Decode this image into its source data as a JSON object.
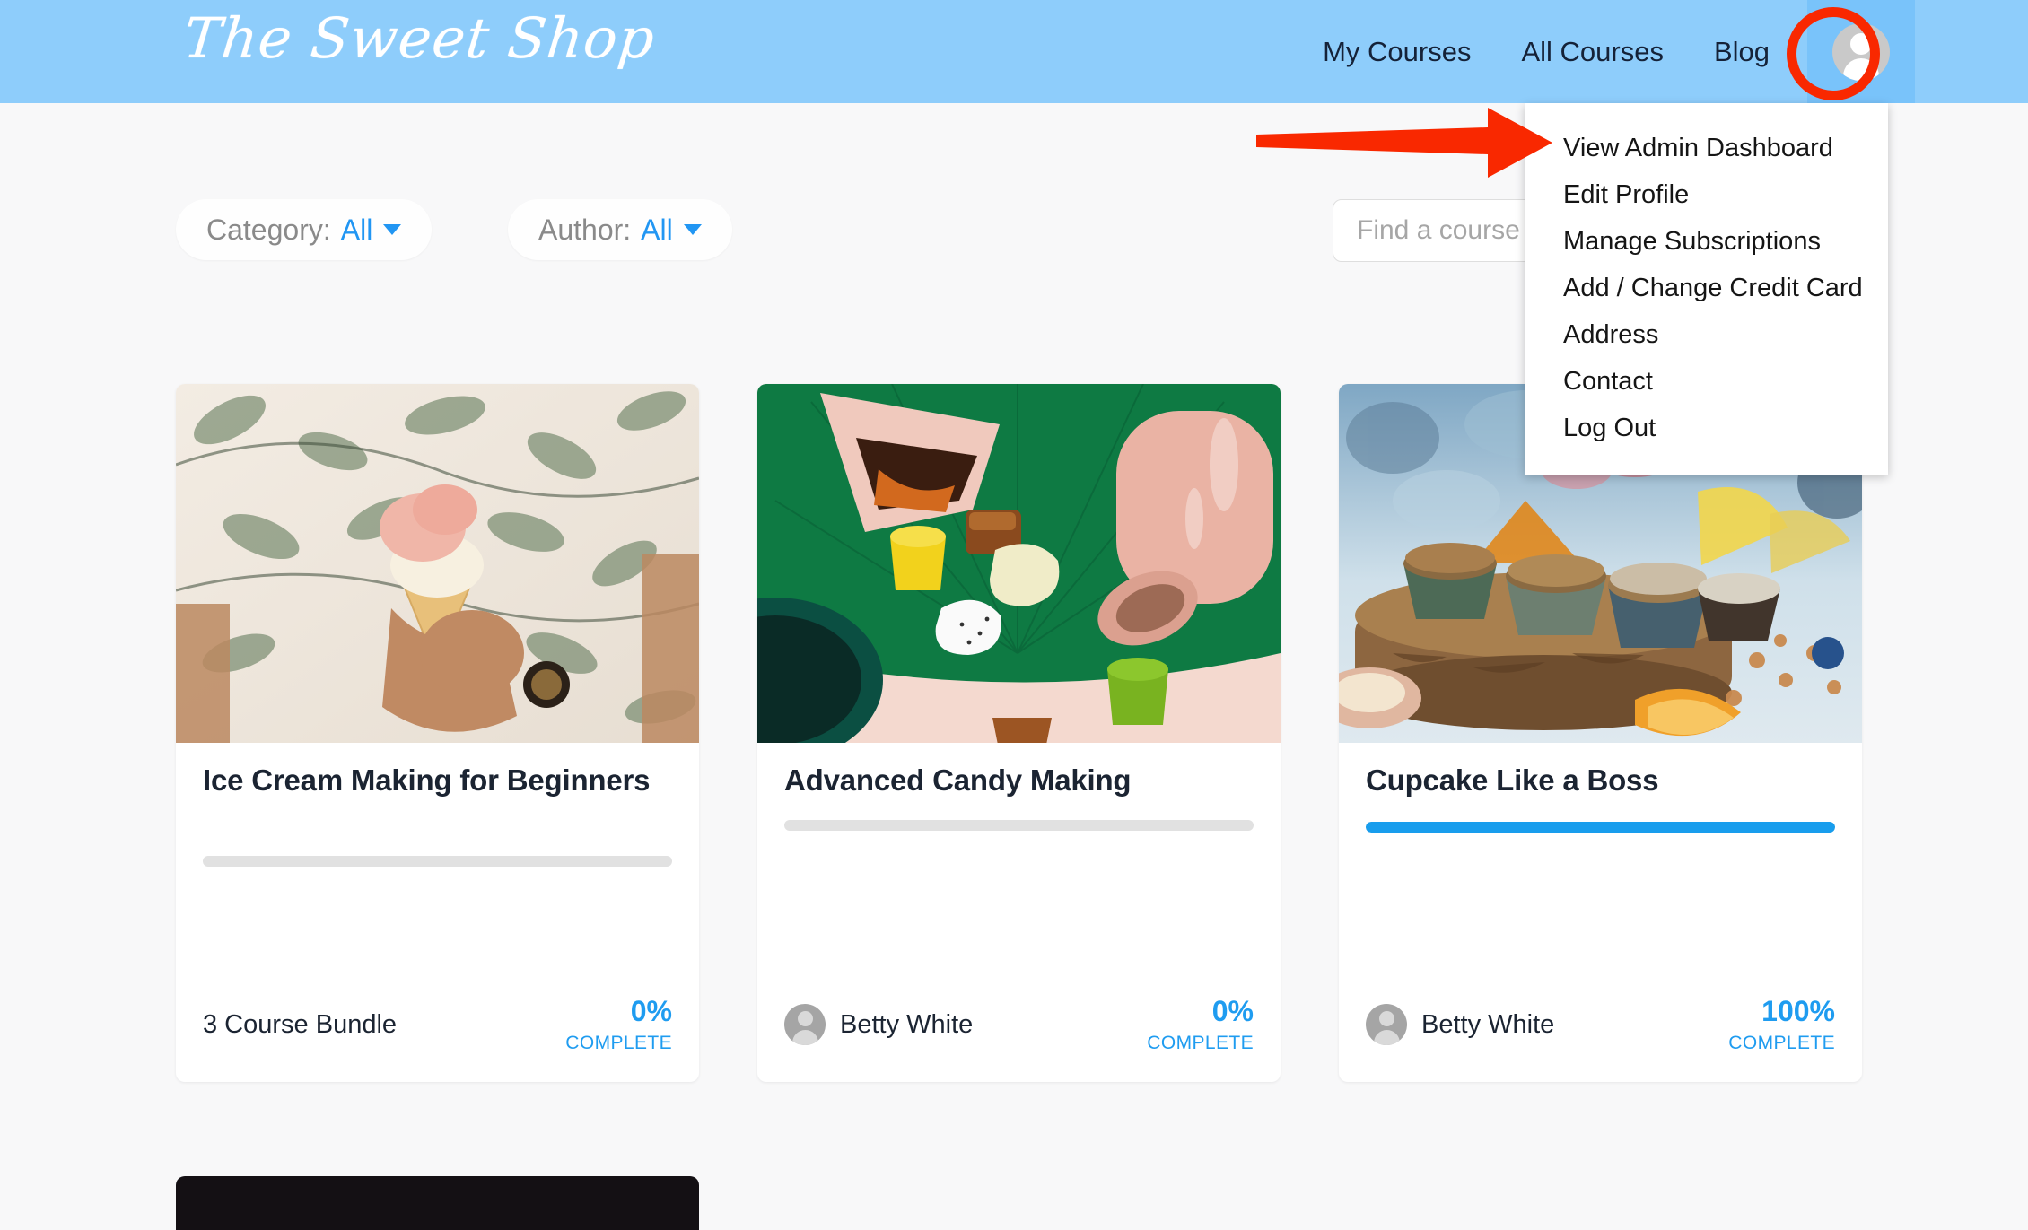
{
  "header": {
    "brand": "The Sweet Shop",
    "brand_color": "#ffffff",
    "bar_color": "#8ecdfb",
    "nav": [
      {
        "label": "My Courses"
      },
      {
        "label": "All Courses"
      },
      {
        "label": "Blog"
      }
    ],
    "avatar_icon": "user-avatar-icon"
  },
  "annotations": {
    "ring_color": "#f92800",
    "arrow_color": "#f92800",
    "arrow_points_to": "View Admin Dashboard"
  },
  "dropdown": {
    "items": [
      {
        "label": "View Admin Dashboard"
      },
      {
        "label": "Edit Profile"
      },
      {
        "label": "Manage Subscriptions"
      },
      {
        "label": "Add / Change Credit Card"
      },
      {
        "label": "Address"
      },
      {
        "label": "Contact"
      },
      {
        "label": "Log Out"
      }
    ]
  },
  "filters": {
    "category": {
      "label": "Category:",
      "value": "All",
      "caret_icon": "chevron-down-icon"
    },
    "author": {
      "label": "Author:",
      "value": "All",
      "caret_icon": "chevron-down-icon"
    },
    "search": {
      "placeholder": "Find a course",
      "value": ""
    }
  },
  "accent_color": "#1f9cf0",
  "courses": [
    {
      "title": "Ice Cream Making for Beginners",
      "meta": "3 Course Bundle",
      "has_author_avatar": false,
      "progress": 0,
      "progress_text": "0%",
      "progress_caption": "COMPLETE",
      "image_alt": "hand holding a two-scoop ice cream cone in front of a leaf-print shirt"
    },
    {
      "title": "Advanced Candy Making",
      "meta": "Betty White",
      "has_author_avatar": true,
      "progress": 0,
      "progress_text": "0%",
      "progress_caption": "COMPLETE",
      "image_alt": "assorted candies on a green leaf mat with a pink ceramic vase"
    },
    {
      "title": "Cupcake Like a Boss",
      "meta": "Betty White",
      "has_author_avatar": true,
      "progress": 100,
      "progress_text": "100%",
      "progress_caption": "COMPLETE",
      "image_alt": "cupcakes on a wooden slice with nuts and fruit"
    }
  ]
}
